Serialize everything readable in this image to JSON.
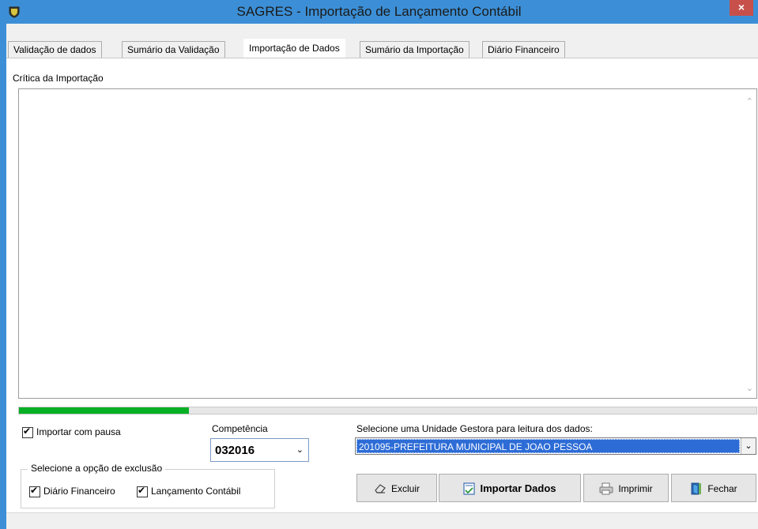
{
  "window": {
    "title": "SAGRES - Importação de Lançamento Contábil",
    "close_label": "×"
  },
  "tabs": [
    {
      "label": "Validação de dados",
      "active": false
    },
    {
      "label": "Sumário da Validação",
      "active": false
    },
    {
      "label": "Importação de Dados",
      "active": true
    },
    {
      "label": "Sumário da Importação",
      "active": false
    },
    {
      "label": "Diário Financeiro",
      "active": false
    }
  ],
  "critica": {
    "label": "Crítica da Importação",
    "text": ""
  },
  "progress": {
    "fraction": 0.23,
    "color": "#06b025"
  },
  "options": {
    "pause_label": "Importar com pausa",
    "pause_checked": true,
    "exclusion_group_label": "Selecione a opção de exclusão",
    "diario_label": "Diário Financeiro",
    "diario_checked": true,
    "lancamento_label": "Lançamento Contábil",
    "lancamento_checked": true
  },
  "competencia": {
    "label": "Competência",
    "value": "032016"
  },
  "unidade": {
    "label": "Selecione uma Unidade Gestora para leitura dos dados:",
    "value": "201095-PREFEITURA MUNICIPAL DE JOAO PESSOA"
  },
  "buttons": {
    "excluir": "Excluir",
    "importar": "Importar Dados",
    "imprimir": "Imprimir",
    "fechar": "Fechar"
  },
  "colors": {
    "title_bar": "#3c8fd6",
    "selection": "#2d6cd6",
    "close": "#c7504b"
  }
}
